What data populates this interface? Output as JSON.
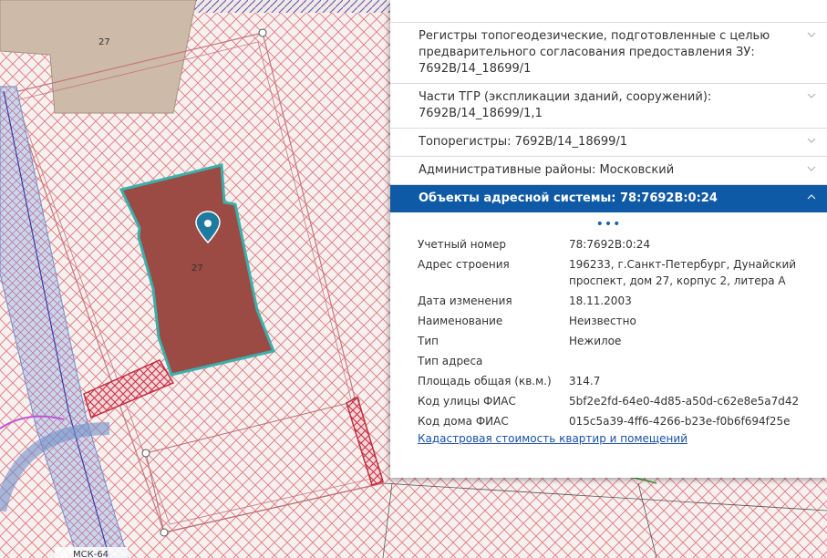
{
  "map": {
    "plot_label_top": "27",
    "building_label": "27",
    "street_label": "МСК-64"
  },
  "panel": {
    "sections": [
      {
        "label": "Регистры топогеодезические, подготовленные с целью предварительного согласования предоставления ЗУ: 7692В/14_18699/1"
      },
      {
        "label": "Части ТГР (экспликации зданий, сооружений): 7692В/14_18699/1,1"
      },
      {
        "label": "Топорегистры: 7692В/14_18699/1"
      },
      {
        "label": "Административные районы: Московский"
      }
    ],
    "active_section": {
      "label": "Объекты адресной системы: 78:7692В:0:24"
    },
    "more_indicator": "•••",
    "properties": [
      {
        "key": "Учетный номер",
        "value": "78:7692В:0:24"
      },
      {
        "key": "Адрес строения",
        "value": "196233, г.Санкт-Петербург, Дунайский проспект, дом 27, корпус 2, литера А"
      },
      {
        "key": "Дата изменения",
        "value": "18.11.2003"
      },
      {
        "key": "Наименование",
        "value": "Неизвестно"
      },
      {
        "key": "Тип",
        "value": "Нежилое"
      },
      {
        "key": "Тип адреса",
        "value": ""
      },
      {
        "key": "Площадь общая (кв.м.)",
        "value": "314.7"
      },
      {
        "key": "Код улицы ФИАС",
        "value": "5bf2e2fd-64e0-4d85-a50d-c62e8e5a7d42"
      },
      {
        "key": "Код дома ФИАС",
        "value": "015c5a39-4ff6-4266-b23e-f0b6f694f25e"
      }
    ],
    "link_label": "Кадастровая стоимость квартир и помещений"
  },
  "colors": {
    "accent": "#0f5aa6",
    "hatch": "#e07a80",
    "building_fill": "#9b4a44",
    "building_outline": "#3ab0ab",
    "link": "#1a4fa8"
  }
}
